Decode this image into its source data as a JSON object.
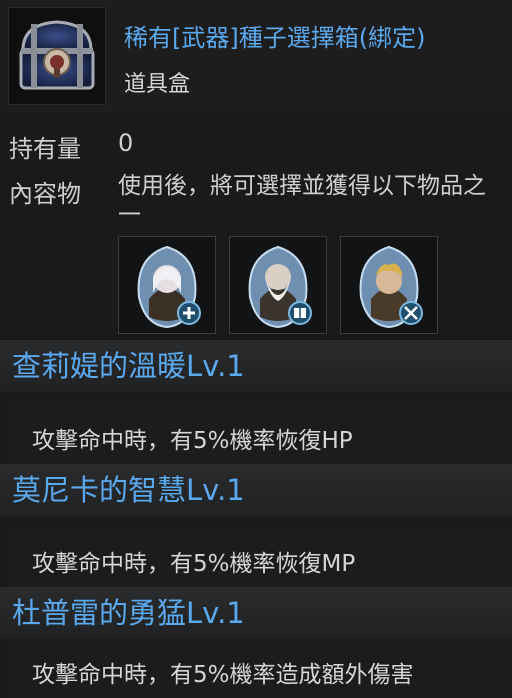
{
  "item": {
    "title": "稀有[武器]種子選擇箱(綁定)",
    "type": "道具盒",
    "icon": "blue-treasure-chest-icon"
  },
  "quantity": {
    "label": "持有量",
    "value": "0"
  },
  "contents": {
    "label": "內容物",
    "description": "使用後，將可選擇並獲得以下物品之一",
    "rewards": [
      {
        "name": "white-haired-girl-seed-icon",
        "badge": "plus-badge-icon"
      },
      {
        "name": "bearded-old-man-seed-icon",
        "badge": "book-badge-icon"
      },
      {
        "name": "blond-warrior-seed-icon",
        "badge": "swords-badge-icon"
      }
    ]
  },
  "effects": [
    {
      "title": "查莉媞的溫暖Lv.1",
      "text": "攻擊命中時，有5%機率恢復HP"
    },
    {
      "title": "莫尼卡的智慧Lv.1",
      "text": "攻擊命中時，有5%機率恢復MP"
    },
    {
      "title": "杜普雷的勇猛Lv.1",
      "text": "攻擊命中時，有5%機率造成額外傷害"
    }
  ],
  "colors": {
    "accent": "#5aa8ee",
    "text": "#d2d2d2",
    "background": "#1b1a1a"
  }
}
